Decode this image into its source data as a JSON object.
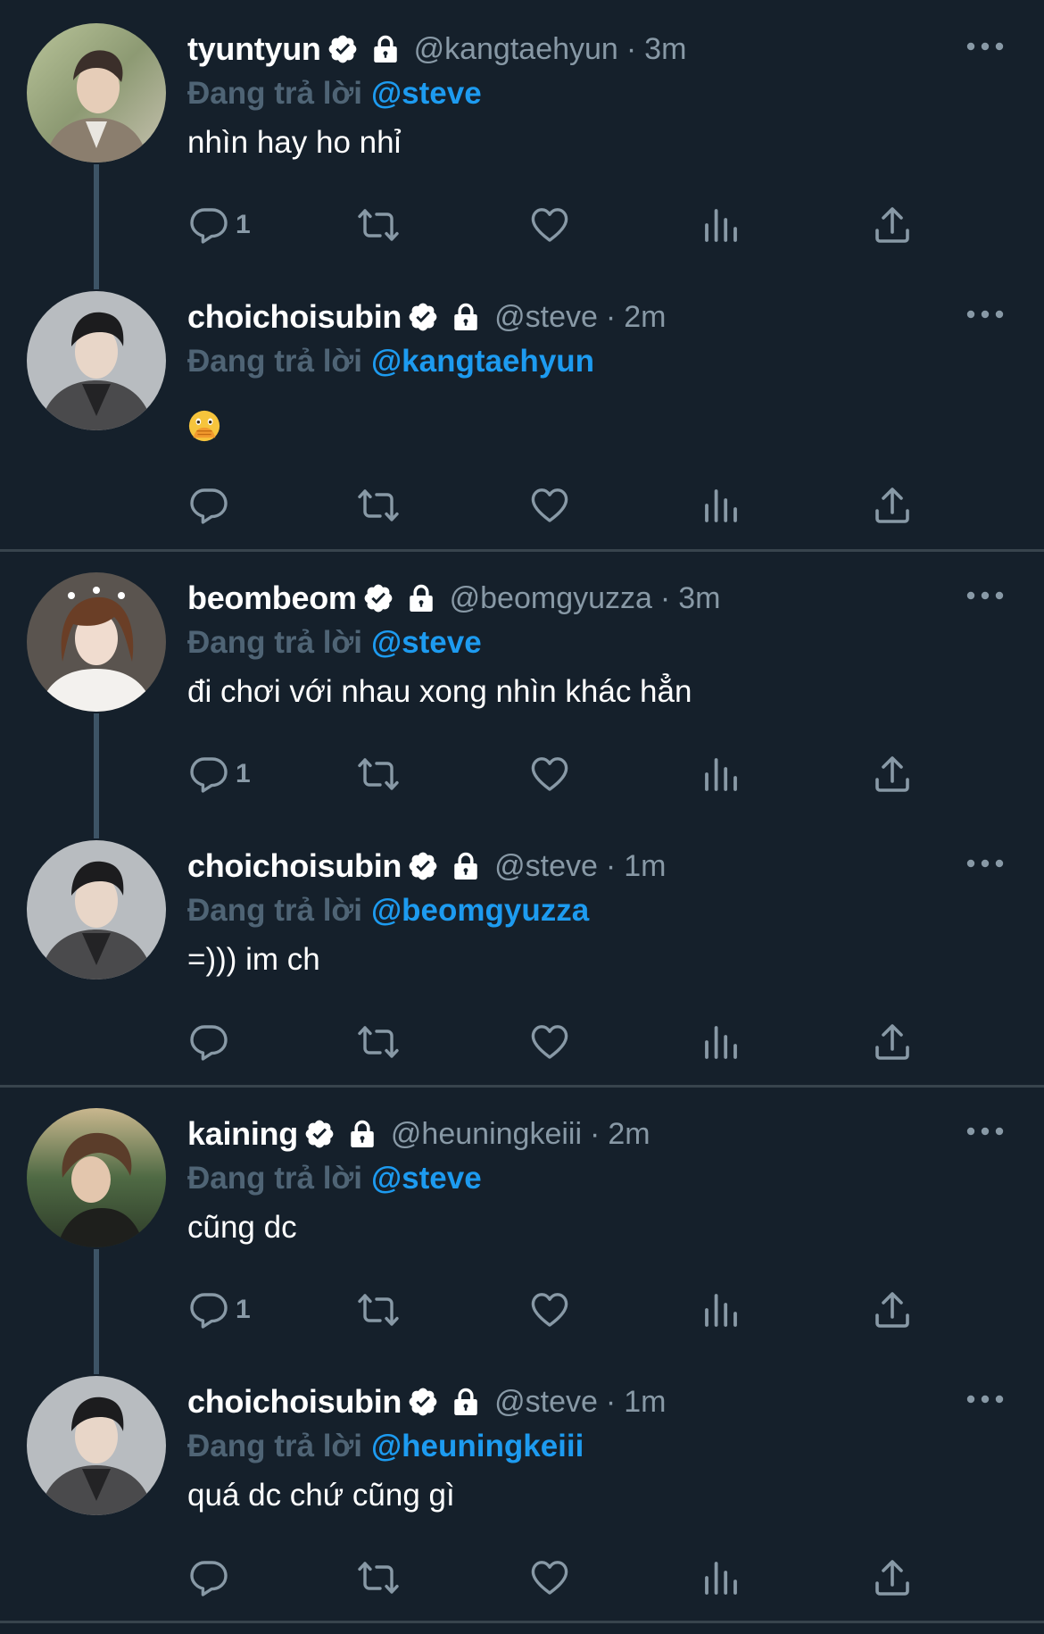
{
  "colors": {
    "background": "#15202b",
    "text_primary": "#ffffff",
    "text_secondary": "#8899a6",
    "reply_prefix": "#4f6475",
    "mention": "#1d9bf0",
    "thread_line": "#3d5466",
    "separator": "#38444d"
  },
  "reply_prefix_label": "Đang trả lời",
  "threads": [
    {
      "tweets": [
        {
          "name": "tyuntyun",
          "verified": true,
          "protected": true,
          "handle": "@kangtaehyun",
          "separator": "·",
          "time": "3m",
          "reply_to": "@steve",
          "text": "nhìn hay ho nhỉ",
          "reply_count": "1",
          "icons": [
            "verified-icon",
            "lock-icon",
            "more-icon",
            "reply-icon",
            "retweet-icon",
            "like-icon",
            "analytics-icon",
            "share-icon"
          ]
        },
        {
          "name": "choichoisubin",
          "verified": true,
          "protected": true,
          "handle": "@steve",
          "separator": "·",
          "time": "2m",
          "reply_to": "@kangtaehyun",
          "text": "",
          "emoji": "face-with-open-eyes-and-hand-over-mouth",
          "reply_count": ""
        }
      ]
    },
    {
      "tweets": [
        {
          "name": "beombeom",
          "verified": true,
          "protected": true,
          "handle": "@beomgyuzza",
          "separator": "·",
          "time": "3m",
          "reply_to": "@steve",
          "text": "đi chơi với nhau xong nhìn khác hẳn",
          "reply_count": "1"
        },
        {
          "name": "choichoisubin",
          "verified": true,
          "protected": true,
          "handle": "@steve",
          "separator": "·",
          "time": "1m",
          "reply_to": "@beomgyuzza",
          "text": "=))) im ch",
          "reply_count": ""
        }
      ]
    },
    {
      "tweets": [
        {
          "name": "kaining",
          "verified": true,
          "protected": true,
          "handle": "@heuningkeiii",
          "separator": "·",
          "time": "2m",
          "reply_to": "@steve",
          "text": "cũng dc",
          "reply_count": "1"
        },
        {
          "name": "choichoisubin",
          "verified": true,
          "protected": true,
          "handle": "@steve",
          "separator": "·",
          "time": "1m",
          "reply_to": "@heuningkeiii",
          "text": "quá dc chứ cũng gì",
          "reply_count": ""
        }
      ]
    }
  ]
}
